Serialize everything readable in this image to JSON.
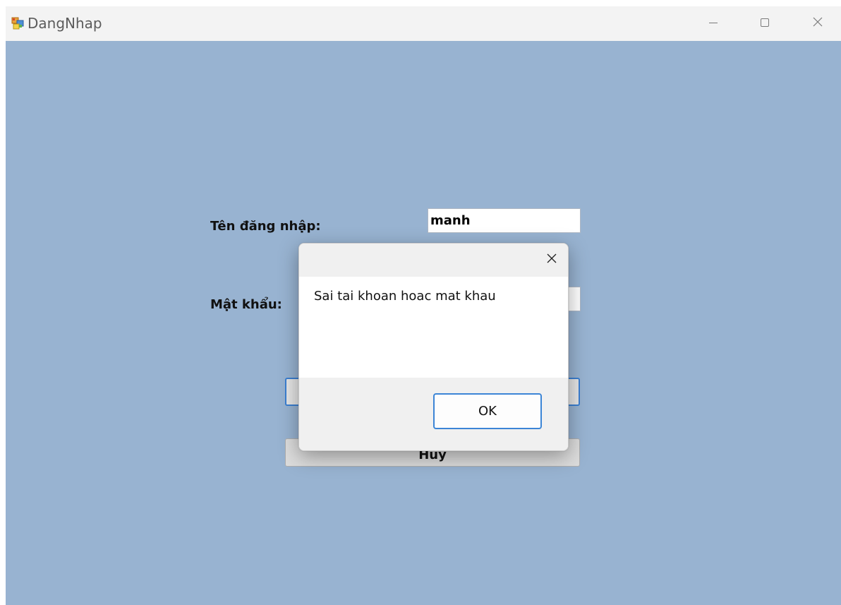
{
  "window": {
    "title": "DangNhap",
    "icon": "winforms-app-icon",
    "background": "#98b3d1"
  },
  "form": {
    "username_label": "Tên đăng nhập:",
    "username_value": "manh",
    "password_label": "Mật khẩu:",
    "password_value": "",
    "login_button_label": "",
    "cancel_button_label": "Huy"
  },
  "message_box": {
    "title": "",
    "message": "Sai tai khoan hoac mat khau",
    "ok_label": "OK",
    "accent": "#3c85d6"
  }
}
